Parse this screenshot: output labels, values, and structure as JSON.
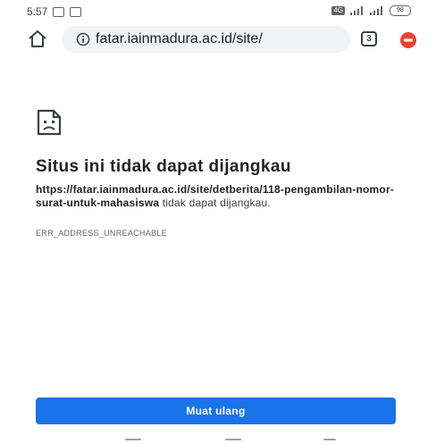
{
  "status_bar": {
    "time": "5:57",
    "network_label": "4G",
    "battery_level": "98"
  },
  "toolbar": {
    "url": "fatar.iainmadura.ac.id/site/",
    "tab_count": "3",
    "icons": [
      "home-icon",
      "info-icon",
      "tab-switcher-icon",
      "extension-icon"
    ]
  },
  "error_page": {
    "title": "Situs ini tidak dapat dijangkau",
    "url_bold": "https://fatar.iainmadura.ac.id/site/detberita/118-pengambilan-nomor-surat-untuk-mahasiswa",
    "desc_suffix": " tidak dapat dijangkau.",
    "error_code": "ERR_ADDRESS_UNREACHABLE",
    "reload_label": "Muat ulang"
  },
  "colors": {
    "accent": "#1a73e8",
    "extension": "#ea4335"
  }
}
